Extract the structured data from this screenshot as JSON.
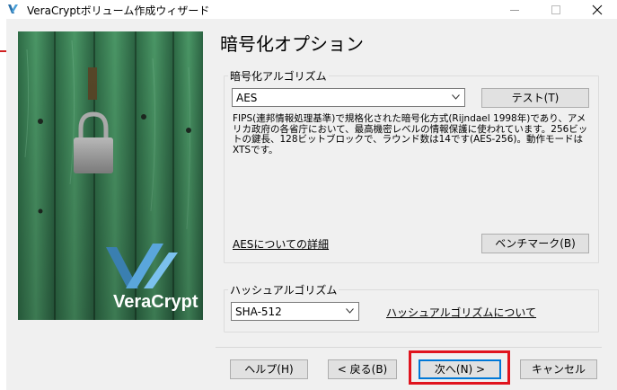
{
  "window": {
    "title": "VeraCryptボリューム作成ウィザード"
  },
  "page": {
    "title": "暗号化オプション"
  },
  "encryption": {
    "group_label": "暗号化アルゴリズム",
    "selected": "AES",
    "test_button": "テスト(T)",
    "description": "FIPS(連邦情報処理基準)で規格化された暗号化方式(Rijndael 1998年)であり、アメリカ政府の各省庁において、最高機密レベルの情報保護に使われています。256ビットの鍵長、128ビットブロックで、ラウンド数は14です(AES-256)。動作モードはXTSです。",
    "details_link": "AESについての詳細",
    "benchmark_button": "ベンチマーク(B)"
  },
  "hash": {
    "group_label": "ハッシュアルゴリズム",
    "selected": "SHA-512",
    "about_link": "ハッシュアルゴリズムについて"
  },
  "footer": {
    "help": "ヘルプ(H)",
    "back": "< 戻る(B)",
    "next": "次へ(N) >",
    "cancel": "キャンセル"
  },
  "hero": {
    "logo_text": "VeraCrypt"
  },
  "colors": {
    "accent_highlight": "#e0141e",
    "hero_green": "#3f8a5c",
    "logo_blue": "#3a7fb0"
  }
}
